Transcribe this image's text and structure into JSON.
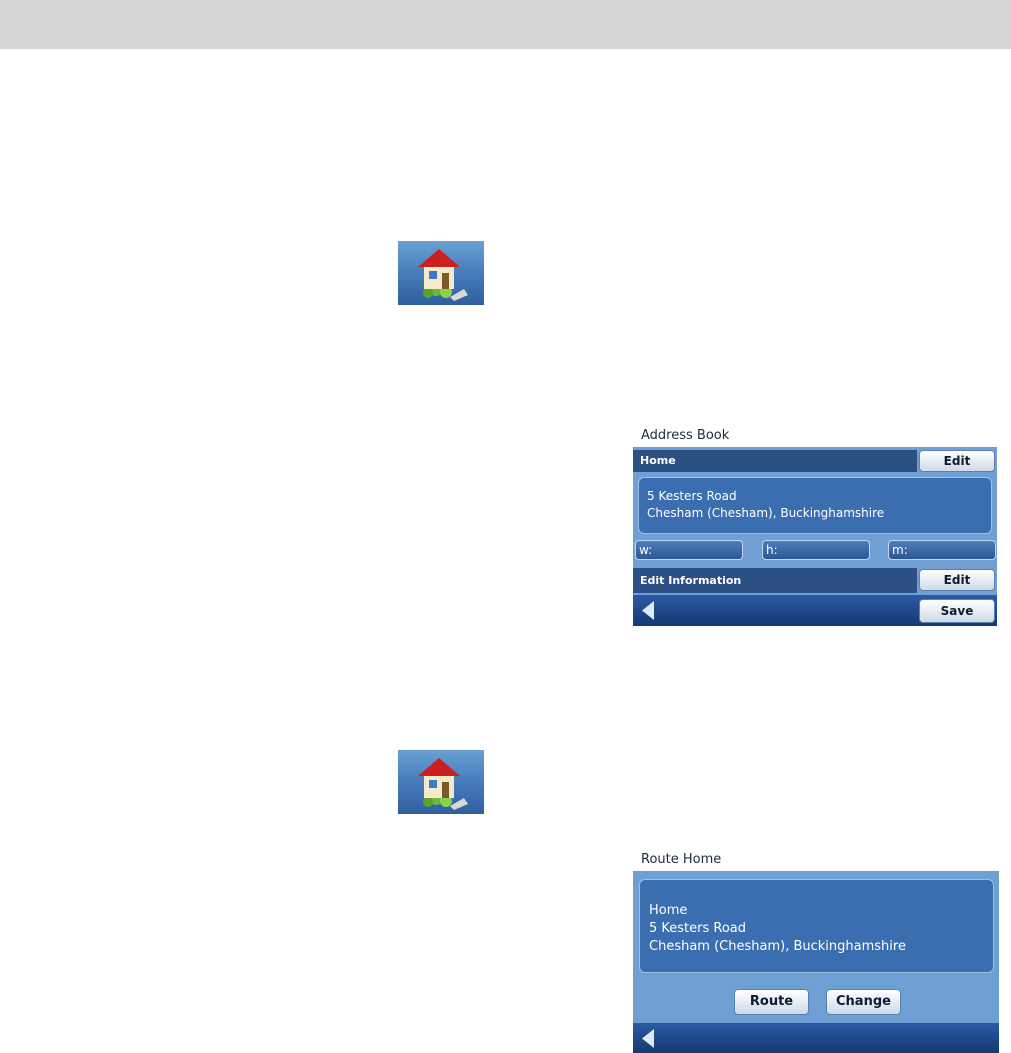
{
  "address_book": {
    "title": "Address Book",
    "home_row": {
      "label": "Home",
      "edit_label": "Edit"
    },
    "address": {
      "line1": "5 Kesters Road",
      "line2": "Chesham (Chesham), Buckinghamshire"
    },
    "phones": {
      "work": "w:",
      "home": "h:",
      "mobile": "m:"
    },
    "edit_info_row": {
      "label": "Edit Information",
      "edit_label": "Edit"
    },
    "save_label": "Save"
  },
  "route_home": {
    "title": "Route Home",
    "info": {
      "name": "Home",
      "line1": "5 Kesters Road",
      "line2": "Chesham (Chesham), Buckinghamshire"
    },
    "route_label": "Route",
    "change_label": "Change"
  },
  "icons": {
    "home": "home-icon",
    "back": "back-arrow-icon"
  },
  "colors": {
    "panel_bg": "#6f9fd3",
    "bar_dark": "#2c4f84",
    "info_blue": "#3b6eb0",
    "header_gray": "#d6d6d6"
  }
}
